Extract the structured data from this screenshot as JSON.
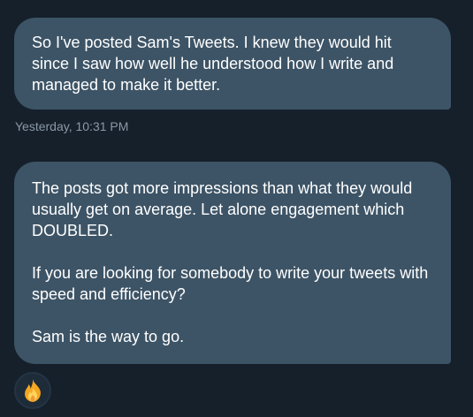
{
  "messages": [
    {
      "paragraphs": [
        "So I've posted Sam's Tweets. I knew they would hit since I saw how well he understood how I write and managed to make it better."
      ]
    },
    {
      "paragraphs": [
        "The posts got more impressions than what they would usually get on average. Let alone engagement which DOUBLED.",
        "If you are looking for somebody to write your tweets with speed and efficiency?",
        "Sam is the way to go."
      ]
    }
  ],
  "timestamp": "Yesterday, 10:31 PM",
  "reaction": {
    "icon": "fire-emoji-icon",
    "colors": {
      "outer": "#f5a623",
      "inner": "#ffd35a",
      "core": "#e8641b"
    }
  },
  "colors": {
    "background": "#15202b",
    "bubble": "#3d5466",
    "text": "#ffffff",
    "timestamp": "#8b98a5"
  }
}
